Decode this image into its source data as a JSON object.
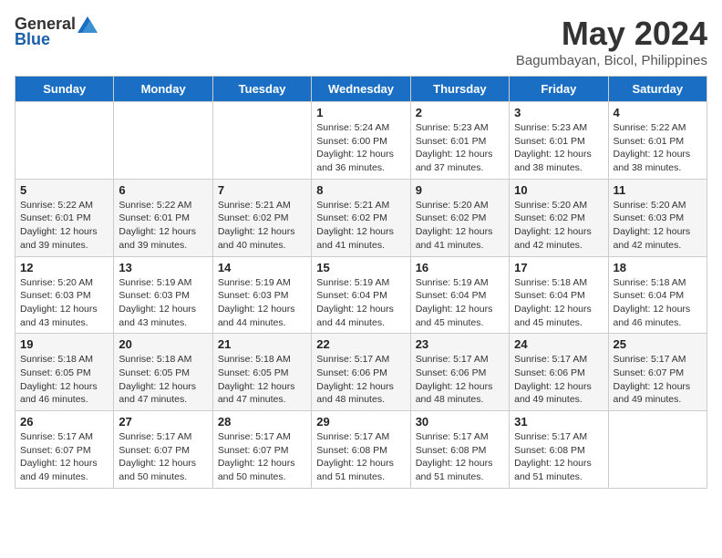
{
  "header": {
    "logo": {
      "general": "General",
      "blue": "Blue"
    },
    "title": "May 2024",
    "location": "Bagumbayan, Bicol, Philippines"
  },
  "weekdays": [
    "Sunday",
    "Monday",
    "Tuesday",
    "Wednesday",
    "Thursday",
    "Friday",
    "Saturday"
  ],
  "rows": [
    {
      "alt": false,
      "cells": [
        null,
        null,
        null,
        {
          "day": 1,
          "sunrise": "5:24 AM",
          "sunset": "6:00 PM",
          "daylight": "12 hours and 36 minutes."
        },
        {
          "day": 2,
          "sunrise": "5:23 AM",
          "sunset": "6:01 PM",
          "daylight": "12 hours and 37 minutes."
        },
        {
          "day": 3,
          "sunrise": "5:23 AM",
          "sunset": "6:01 PM",
          "daylight": "12 hours and 38 minutes."
        },
        {
          "day": 4,
          "sunrise": "5:22 AM",
          "sunset": "6:01 PM",
          "daylight": "12 hours and 38 minutes."
        }
      ]
    },
    {
      "alt": true,
      "cells": [
        {
          "day": 5,
          "sunrise": "5:22 AM",
          "sunset": "6:01 PM",
          "daylight": "12 hours and 39 minutes."
        },
        {
          "day": 6,
          "sunrise": "5:22 AM",
          "sunset": "6:01 PM",
          "daylight": "12 hours and 39 minutes."
        },
        {
          "day": 7,
          "sunrise": "5:21 AM",
          "sunset": "6:02 PM",
          "daylight": "12 hours and 40 minutes."
        },
        {
          "day": 8,
          "sunrise": "5:21 AM",
          "sunset": "6:02 PM",
          "daylight": "12 hours and 41 minutes."
        },
        {
          "day": 9,
          "sunrise": "5:20 AM",
          "sunset": "6:02 PM",
          "daylight": "12 hours and 41 minutes."
        },
        {
          "day": 10,
          "sunrise": "5:20 AM",
          "sunset": "6:02 PM",
          "daylight": "12 hours and 42 minutes."
        },
        {
          "day": 11,
          "sunrise": "5:20 AM",
          "sunset": "6:03 PM",
          "daylight": "12 hours and 42 minutes."
        }
      ]
    },
    {
      "alt": false,
      "cells": [
        {
          "day": 12,
          "sunrise": "5:20 AM",
          "sunset": "6:03 PM",
          "daylight": "12 hours and 43 minutes."
        },
        {
          "day": 13,
          "sunrise": "5:19 AM",
          "sunset": "6:03 PM",
          "daylight": "12 hours and 43 minutes."
        },
        {
          "day": 14,
          "sunrise": "5:19 AM",
          "sunset": "6:03 PM",
          "daylight": "12 hours and 44 minutes."
        },
        {
          "day": 15,
          "sunrise": "5:19 AM",
          "sunset": "6:04 PM",
          "daylight": "12 hours and 44 minutes."
        },
        {
          "day": 16,
          "sunrise": "5:19 AM",
          "sunset": "6:04 PM",
          "daylight": "12 hours and 45 minutes."
        },
        {
          "day": 17,
          "sunrise": "5:18 AM",
          "sunset": "6:04 PM",
          "daylight": "12 hours and 45 minutes."
        },
        {
          "day": 18,
          "sunrise": "5:18 AM",
          "sunset": "6:04 PM",
          "daylight": "12 hours and 46 minutes."
        }
      ]
    },
    {
      "alt": true,
      "cells": [
        {
          "day": 19,
          "sunrise": "5:18 AM",
          "sunset": "6:05 PM",
          "daylight": "12 hours and 46 minutes."
        },
        {
          "day": 20,
          "sunrise": "5:18 AM",
          "sunset": "6:05 PM",
          "daylight": "12 hours and 47 minutes."
        },
        {
          "day": 21,
          "sunrise": "5:18 AM",
          "sunset": "6:05 PM",
          "daylight": "12 hours and 47 minutes."
        },
        {
          "day": 22,
          "sunrise": "5:17 AM",
          "sunset": "6:06 PM",
          "daylight": "12 hours and 48 minutes."
        },
        {
          "day": 23,
          "sunrise": "5:17 AM",
          "sunset": "6:06 PM",
          "daylight": "12 hours and 48 minutes."
        },
        {
          "day": 24,
          "sunrise": "5:17 AM",
          "sunset": "6:06 PM",
          "daylight": "12 hours and 49 minutes."
        },
        {
          "day": 25,
          "sunrise": "5:17 AM",
          "sunset": "6:07 PM",
          "daylight": "12 hours and 49 minutes."
        }
      ]
    },
    {
      "alt": false,
      "cells": [
        {
          "day": 26,
          "sunrise": "5:17 AM",
          "sunset": "6:07 PM",
          "daylight": "12 hours and 49 minutes."
        },
        {
          "day": 27,
          "sunrise": "5:17 AM",
          "sunset": "6:07 PM",
          "daylight": "12 hours and 50 minutes."
        },
        {
          "day": 28,
          "sunrise": "5:17 AM",
          "sunset": "6:07 PM",
          "daylight": "12 hours and 50 minutes."
        },
        {
          "day": 29,
          "sunrise": "5:17 AM",
          "sunset": "6:08 PM",
          "daylight": "12 hours and 51 minutes."
        },
        {
          "day": 30,
          "sunrise": "5:17 AM",
          "sunset": "6:08 PM",
          "daylight": "12 hours and 51 minutes."
        },
        {
          "day": 31,
          "sunrise": "5:17 AM",
          "sunset": "6:08 PM",
          "daylight": "12 hours and 51 minutes."
        },
        null
      ]
    }
  ],
  "labels": {
    "sunrise": "Sunrise:",
    "sunset": "Sunset:",
    "daylight": "Daylight:"
  }
}
